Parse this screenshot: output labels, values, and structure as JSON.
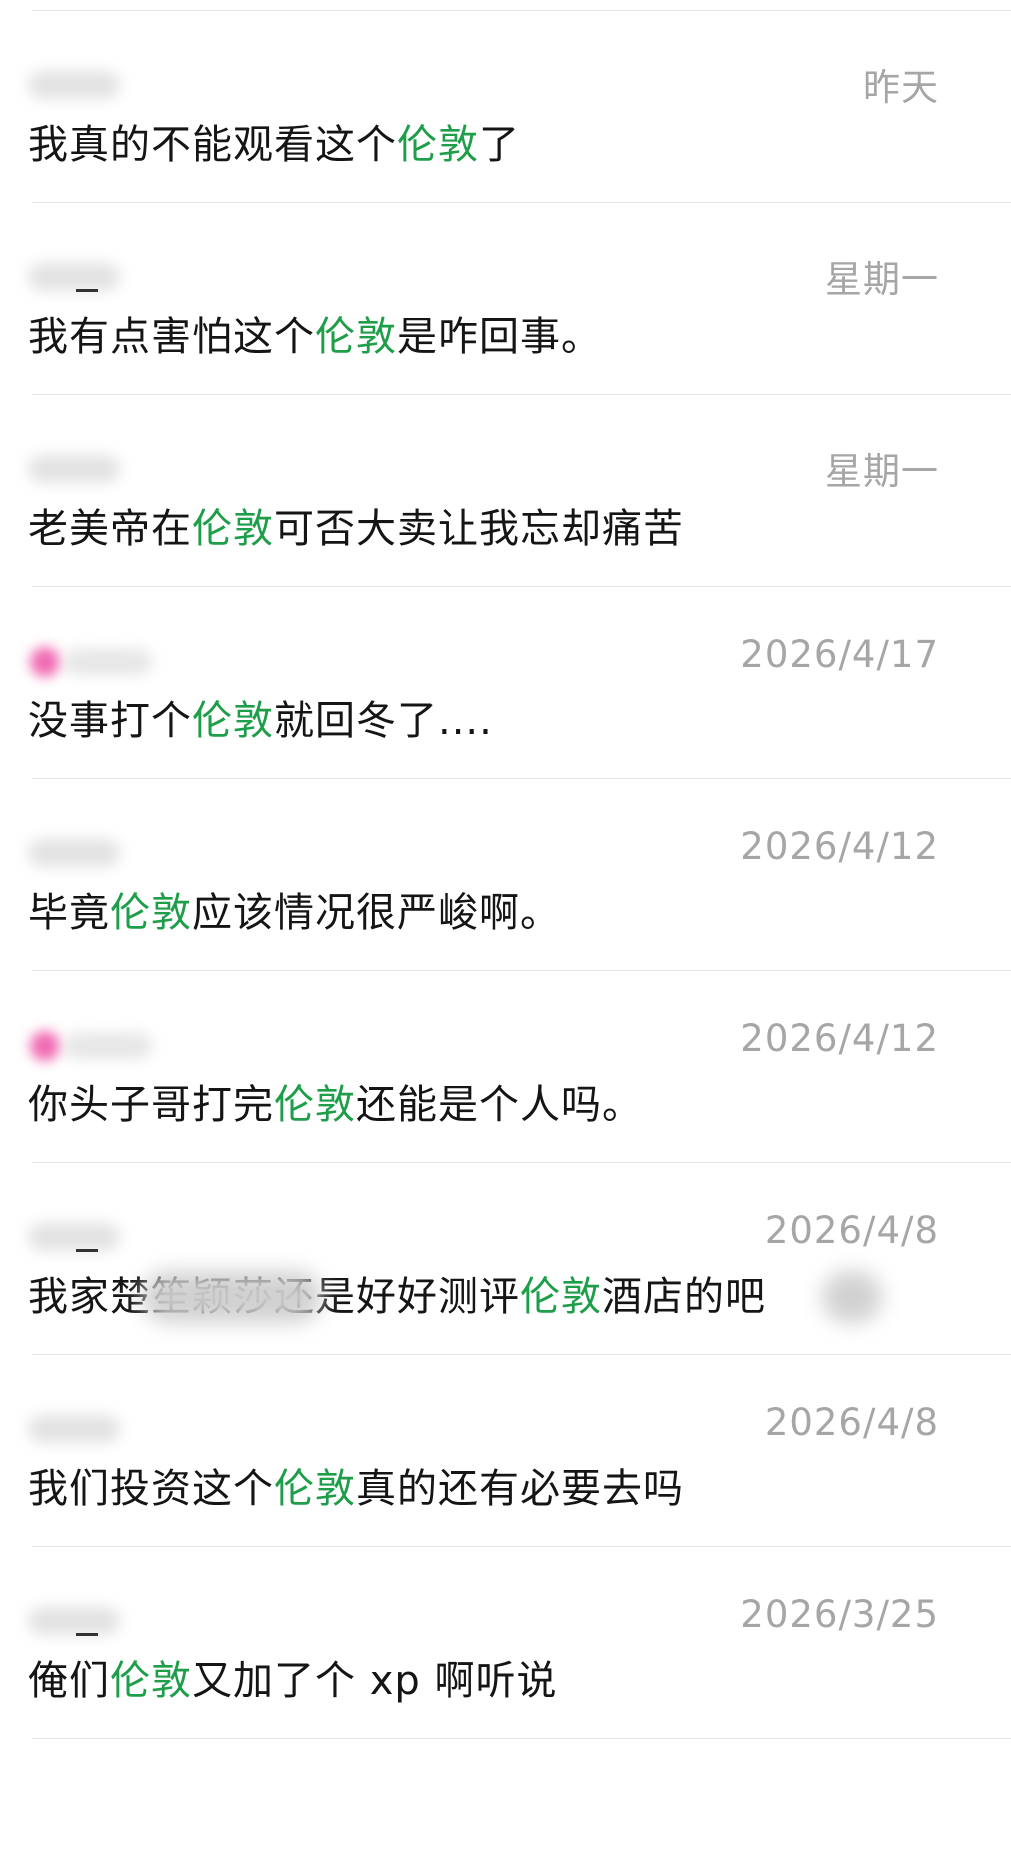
{
  "keyword_color": "#1f9e4a",
  "time_color": "#a6a6a6",
  "messages": [
    {
      "sender_style": "blur",
      "time": "昨天",
      "before": "我真的不能观看这个",
      "keyword": "伦敦",
      "after": "了"
    },
    {
      "sender_style": "blur-underscore",
      "time": "星期一",
      "before": "我有点害怕这个",
      "keyword": "伦敦",
      "after": "是咋回事。"
    },
    {
      "sender_style": "blur",
      "time": "星期一",
      "before": "老美帝在",
      "keyword": "伦敦",
      "after": "可否大卖让我忘却痛苦"
    },
    {
      "sender_style": "pink-avatar",
      "time": "2026/4/17",
      "before": "没事打个",
      "keyword": "伦敦",
      "after": "就回冬了...."
    },
    {
      "sender_style": "blur",
      "time": "2026/4/12",
      "before": "毕竟",
      "keyword": "伦敦",
      "after": "应该情况很严峻啊。"
    },
    {
      "sender_style": "pink-avatar",
      "time": "2026/4/12",
      "before": "你头子哥打完",
      "keyword": "伦敦",
      "after": "还能是个人吗。"
    },
    {
      "sender_style": "blur-underscore",
      "time": "2026/4/8",
      "before": "我家楚笙颖莎还是好好测评",
      "keyword": "伦敦",
      "after": "酒店的吧"
    },
    {
      "sender_style": "blur",
      "time": "2026/4/8",
      "before": "我们投资这个",
      "keyword": "伦敦",
      "after": "真的还有必要去吗"
    },
    {
      "sender_style": "blur-underscore",
      "time": "2026/3/25",
      "before": "俺们",
      "keyword": "伦敦",
      "after": "又加了个 xp 啊听说"
    }
  ]
}
